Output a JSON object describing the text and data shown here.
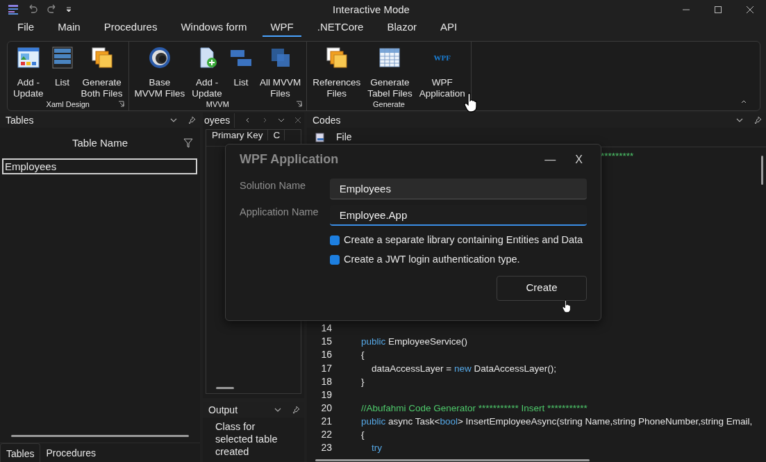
{
  "window": {
    "title": "Interactive Mode"
  },
  "menu_tabs": [
    {
      "label": "File",
      "selected": false
    },
    {
      "label": "Main",
      "selected": false
    },
    {
      "label": "Procedures",
      "selected": false
    },
    {
      "label": "Windows form",
      "selected": false
    },
    {
      "label": "WPF",
      "selected": true
    },
    {
      "label": ".NETCore",
      "selected": false
    },
    {
      "label": "Blazor",
      "selected": false
    },
    {
      "label": "API",
      "selected": false
    }
  ],
  "ribbon": {
    "groups": [
      {
        "label": "Xaml Design",
        "launcher": true,
        "buttons": [
          {
            "kind": "window",
            "label": "Add -\nUpdate"
          },
          {
            "kind": "list",
            "label": "List"
          },
          {
            "kind": "copy",
            "label": "Generate\nBoth Files"
          }
        ]
      },
      {
        "label": "MVVM",
        "launcher": true,
        "buttons": [
          {
            "kind": "swirl",
            "label": "Base\nMVVM Files"
          },
          {
            "kind": "file-add",
            "label": "Add -\nUpdate"
          },
          {
            "kind": "bars",
            "label": "List"
          },
          {
            "kind": "squares",
            "label": "All MVVM\nFiles"
          }
        ]
      },
      {
        "label": "Generate",
        "launcher": false,
        "buttons": [
          {
            "kind": "copy",
            "label": "References\nFiles"
          },
          {
            "kind": "grid",
            "label": "Generate\nTabel Files"
          },
          {
            "kind": "text-logo",
            "logo": "WPF",
            "label": "WPF\nApplication"
          }
        ]
      }
    ]
  },
  "tables_pane": {
    "title": "Tables",
    "column": "Table Name",
    "rows": [
      {
        "name": "Employees",
        "selected": true
      }
    ]
  },
  "bottom_tabs": [
    {
      "label": "Tables",
      "selected": true
    },
    {
      "label": "Procedures",
      "selected": false
    }
  ],
  "document_pane": {
    "tab": "oyees",
    "columns": [
      "Primary Key",
      "C"
    ]
  },
  "output_pane": {
    "title": "Output",
    "message": "Class for selected table created"
  },
  "codes_pane": {
    "title": "Codes",
    "toolbar_item": "File",
    "line_1_tail": "*********",
    "lines": [
      {
        "number": "14"
      },
      {
        "number": "15",
        "tokens": [
          {
            "kind": "keyword",
            "text": "public"
          },
          {
            "kind": "plain",
            "text": " EmployeeService()"
          }
        ]
      },
      {
        "number": "16",
        "tokens": [
          {
            "kind": "plain",
            "text": "{"
          }
        ]
      },
      {
        "number": "17",
        "tokens": [
          {
            "kind": "plain",
            "text": "    dataAccessLayer = "
          },
          {
            "kind": "keyword",
            "text": "new"
          },
          {
            "kind": "plain",
            "text": " DataAccessLayer();"
          }
        ]
      },
      {
        "number": "18",
        "tokens": [
          {
            "kind": "plain",
            "text": "}"
          }
        ]
      },
      {
        "number": "19"
      },
      {
        "number": "20",
        "tokens": [
          {
            "kind": "comment",
            "text": "//Abufahmi Code Generator *********** Insert ***********"
          }
        ]
      },
      {
        "number": "21",
        "tokens": [
          {
            "kind": "keyword",
            "text": "public"
          },
          {
            "kind": "plain",
            "text": " async Task<"
          },
          {
            "kind": "keyword",
            "text": "bool"
          },
          {
            "kind": "plain",
            "text": "> InsertEmployeeAsync(string Name,string PhoneNumber,string Email,"
          }
        ]
      },
      {
        "number": "22",
        "tokens": [
          {
            "kind": "plain",
            "text": "{"
          }
        ]
      },
      {
        "number": "23",
        "tokens": [
          {
            "kind": "keyword",
            "text": "    try"
          }
        ]
      }
    ]
  },
  "dialog": {
    "title": "WPF Application",
    "minimize": "—",
    "close": "X",
    "fields": [
      {
        "label": "Solution Name",
        "value": "Employees",
        "focused": false
      },
      {
        "label": "Application Name",
        "value": "Employee.App",
        "focused": true
      }
    ],
    "options": [
      {
        "label": "Create a separate library containing Entities and Data",
        "checked": true
      },
      {
        "label": "Create a JWT login authentication type.",
        "checked": true
      }
    ],
    "button": "Create"
  }
}
